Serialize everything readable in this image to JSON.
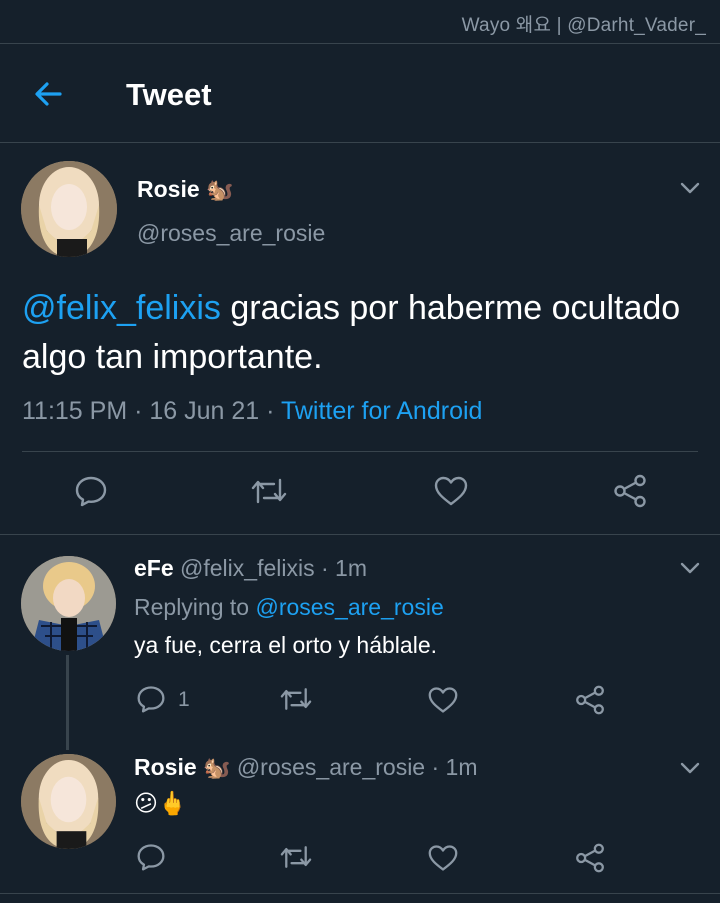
{
  "watermark": "Wayo 왜요 | @Darht_Vader_",
  "header": {
    "title": "Tweet",
    "back_icon": "arrow-left-icon"
  },
  "main_tweet": {
    "name": "Rosie",
    "name_emoji": "🐿️",
    "handle": "@roses_are_rosie",
    "mention": "@felix_felixis",
    "text": " gracias por haberme ocultado algo tan importante.",
    "time": "11:15 PM · 16 Jun 21 · ",
    "source": "Twitter for Android"
  },
  "reply1": {
    "name": "eFe",
    "handle_time": " @felix_felixis · 1m",
    "replying_prefix": "Replying to ",
    "replying_handle": "@roses_are_rosie",
    "text": "ya fue, cerra el orto y háblale.",
    "reply_count": "1"
  },
  "reply2": {
    "name": "Rosie",
    "name_emoji": "🐿️",
    "handle_time": " @roses_are_rosie · 1m",
    "text": "😕🖕"
  },
  "colors": {
    "background": "#15202b",
    "accent": "#1da1f2",
    "muted": "#8b98a5",
    "divider": "#38444d"
  }
}
